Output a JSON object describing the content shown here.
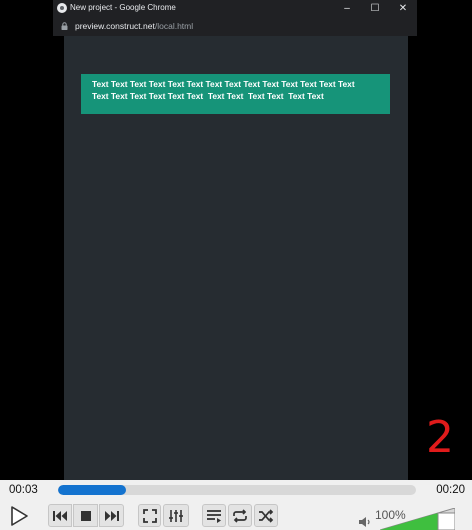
{
  "chrome": {
    "title": "New project - Google Chrome",
    "url_host": "preview.construct.net",
    "url_path": "/local.html",
    "minimize_glyph": "–",
    "maximize_glyph": "☐",
    "close_glyph": "✕"
  },
  "page": {
    "text_line_1": "Text Text Text Text Text Text Text Text Text Text Text Text Text Text",
    "text_line_2": "Text Text Text Text Text Text  Text Text  Text Text  Text Text",
    "text_box_color": "#169479",
    "background_color": "#262c31"
  },
  "annotation": {
    "handwritten_number": "2",
    "color": "#e01b1b"
  },
  "player": {
    "time_current": "00:03",
    "time_total": "00:20",
    "progress": 0.19,
    "volume_label": "100%",
    "volume": 1.0,
    "accent": "#1473cf",
    "controls": {
      "play": "play-icon",
      "prev": "skip-back-icon",
      "stop": "stop-icon",
      "next": "skip-forward-icon",
      "fullscreen": "fullscreen-icon",
      "extended": "equalizer-icon",
      "playlist": "playlist-icon",
      "loop": "loop-icon",
      "shuffle": "shuffle-icon"
    }
  }
}
